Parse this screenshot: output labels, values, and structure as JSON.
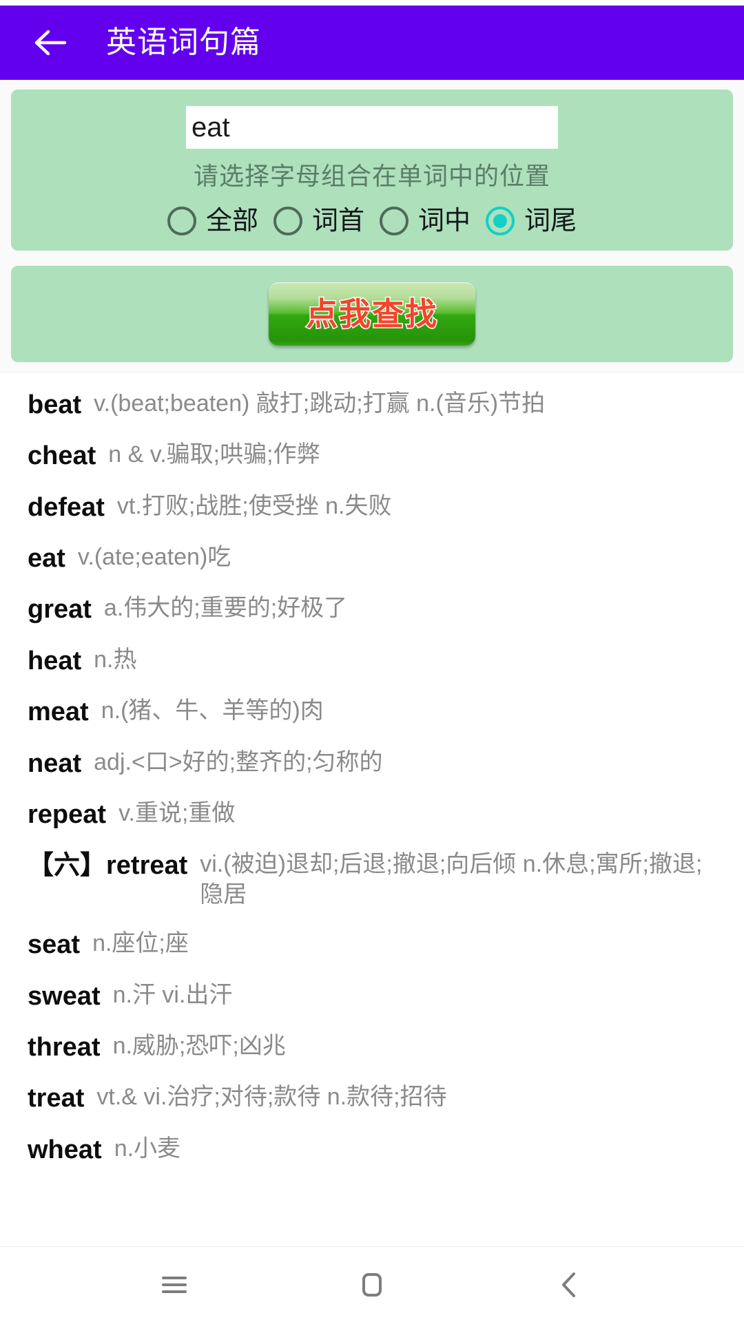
{
  "appbar": {
    "back_icon": "back-arrow-icon",
    "title": "英语词句篇"
  },
  "search_panel": {
    "query_value": "eat",
    "query_placeholder": "",
    "hint": "请选择字母组合在单词中的位置",
    "options": [
      {
        "label": "全部",
        "selected": false
      },
      {
        "label": "词首",
        "selected": false
      },
      {
        "label": "词中",
        "selected": false
      },
      {
        "label": "词尾",
        "selected": true
      }
    ],
    "panel_color": "#AEE0BC",
    "accent_color": "#14CFC4"
  },
  "action_panel": {
    "search_button_label": "点我查找",
    "button_text_color": "#F2452B"
  },
  "results": [
    {
      "word": "beat",
      "definition": "v.(beat;beaten) 敲打;跳动;打赢 n.(音乐)节拍"
    },
    {
      "word": "cheat",
      "definition": "n & v.骗取;哄骗;作弊"
    },
    {
      "word": "defeat",
      "definition": "vt.打败;战胜;使受挫 n.失败"
    },
    {
      "word": "eat",
      "definition": "v.(ate;eaten)吃"
    },
    {
      "word": "great",
      "definition": "a.伟大的;重要的;好极了"
    },
    {
      "word": "heat",
      "definition": "n.热"
    },
    {
      "word": "meat",
      "definition": "n.(猪、牛、羊等的)肉"
    },
    {
      "word": "neat",
      "definition": "adj.<口>好的;整齐的;匀称的"
    },
    {
      "word": "repeat",
      "definition": "v.重说;重做"
    },
    {
      "word": "【六】retreat",
      "definition": "vi.(被迫)退却;后退;撤退;向后倾 n.休息;寓所;撤退;隐居"
    },
    {
      "word": "seat",
      "definition": "n.座位;座"
    },
    {
      "word": "sweat",
      "definition": "n.汗 vi.出汗"
    },
    {
      "word": "threat",
      "definition": "n.威胁;恐吓;凶兆"
    },
    {
      "word": "treat",
      "definition": "vt.& vi.治疗;对待;款待 n.款待;招待"
    },
    {
      "word": "wheat",
      "definition": "n.小麦"
    }
  ],
  "navbar": {
    "items": [
      {
        "icon": "menu-icon"
      },
      {
        "icon": "home-square-icon"
      },
      {
        "icon": "back-chevron-icon"
      }
    ]
  },
  "colors": {
    "appbar": "#6200EE",
    "panel_green": "#AEE0BC",
    "accent_cyan": "#14CFC4",
    "word_text": "#0d0d0d",
    "definition_text": "#8a8a8a"
  }
}
